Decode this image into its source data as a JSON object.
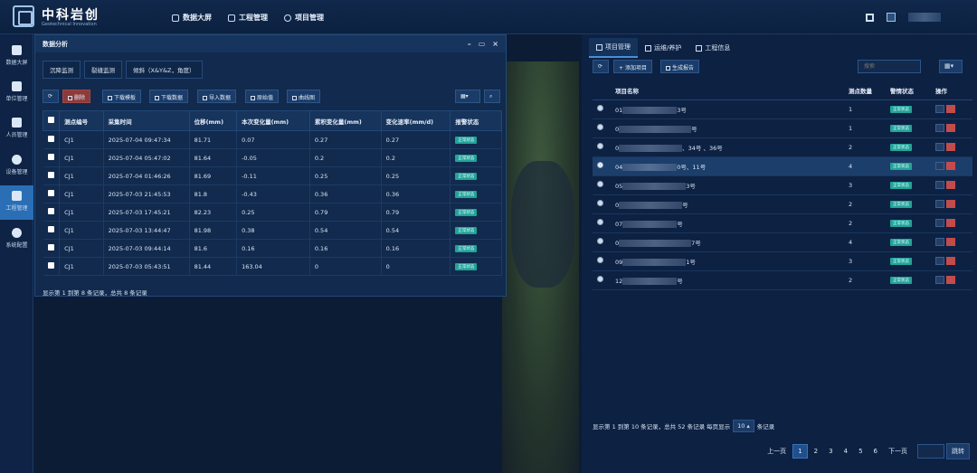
{
  "app": {
    "brand": "中科岩创",
    "brand_sub": "Geotechnical Innovation",
    "nav": [
      "数据大屏",
      "工程管理",
      "项目管理"
    ]
  },
  "sidebar": [
    {
      "label": "数据大屏",
      "icon": "cube-icon"
    },
    {
      "label": "单位管理",
      "icon": "calendar-icon"
    },
    {
      "label": "人员管理",
      "icon": "id-card-icon"
    },
    {
      "label": "设备管理",
      "icon": "gear-icon"
    },
    {
      "label": "工程管理",
      "icon": "chart-icon",
      "active": true
    },
    {
      "label": "系统配置",
      "icon": "more-icon"
    }
  ],
  "left_panel": {
    "title": "数据分析",
    "tabs": [
      "沉降监测",
      "裂缝监测",
      "倾斜（X&Y&Z，角度）"
    ],
    "toolbar": {
      "delete": "删除",
      "template": "下载模板",
      "download": "下载数据",
      "import": "导入数据",
      "raw": "原始值",
      "curve": "曲线图"
    },
    "columns": [
      "测点编号",
      "采集时间",
      "位移(mm)",
      "本次变化量(mm)",
      "累积变化量(mm)",
      "变化速率(mm/d)",
      "报警状态"
    ],
    "rows": [
      {
        "id": "CJ1",
        "time": "2025-07-04 09:47:34",
        "disp": "81.71",
        "delta": "0.07",
        "cum": "0.27",
        "rate": "0.27",
        "status": "正常状态"
      },
      {
        "id": "CJ1",
        "time": "2025-07-04 05:47:02",
        "disp": "81.64",
        "delta": "-0.05",
        "cum": "0.2",
        "rate": "0.2",
        "status": "正常状态"
      },
      {
        "id": "CJ1",
        "time": "2025-07-04 01:46:26",
        "disp": "81.69",
        "delta": "-0.11",
        "cum": "0.25",
        "rate": "0.25",
        "status": "正常状态"
      },
      {
        "id": "CJ1",
        "time": "2025-07-03 21:45:53",
        "disp": "81.8",
        "delta": "-0.43",
        "cum": "0.36",
        "rate": "0.36",
        "status": "正常状态"
      },
      {
        "id": "CJ1",
        "time": "2025-07-03 17:45:21",
        "disp": "82.23",
        "delta": "0.25",
        "cum": "0.79",
        "rate": "0.79",
        "status": "正常状态"
      },
      {
        "id": "CJ1",
        "time": "2025-07-03 13:44:47",
        "disp": "81.98",
        "delta": "0.38",
        "cum": "0.54",
        "rate": "0.54",
        "status": "正常状态"
      },
      {
        "id": "CJ1",
        "time": "2025-07-03 09:44:14",
        "disp": "81.6",
        "delta": "0.16",
        "cum": "0.16",
        "rate": "0.16",
        "status": "正常状态"
      },
      {
        "id": "CJ1",
        "time": "2025-07-03 05:43:51",
        "disp": "81.44",
        "delta": "163.04",
        "cum": "0",
        "rate": "0",
        "status": "正常状态"
      }
    ],
    "footer": "显示第 1 到第 8 条记录，总共 8 条记录"
  },
  "right_panel": {
    "tabs": [
      "项目管理",
      "运维/养护",
      "工程信息"
    ],
    "add": "添加项目",
    "report": "生成报告",
    "search_placeholder": "搜索",
    "columns": [
      "项目名称",
      "测点数量",
      "警情状态",
      "操作"
    ],
    "rows": [
      {
        "prefix": "01",
        "suffix": "3号",
        "count": "1",
        "status": "正常状态"
      },
      {
        "prefix": "0",
        "suffix": "号",
        "count": "1",
        "status": "正常状态"
      },
      {
        "prefix": "0",
        "suffix": "、34号 、36号",
        "count": "2",
        "status": "正常状态"
      },
      {
        "prefix": "04",
        "suffix": "0号、11号",
        "count": "4",
        "status": "正常状态",
        "selected": true
      },
      {
        "prefix": "05",
        "suffix": "3号",
        "count": "3",
        "status": "正常状态"
      },
      {
        "prefix": "0",
        "suffix": "号",
        "count": "2",
        "status": "正常状态"
      },
      {
        "prefix": "07",
        "suffix": "号",
        "count": "2",
        "status": "正常状态"
      },
      {
        "prefix": "0",
        "suffix": "7号",
        "count": "4",
        "status": "正常状态"
      },
      {
        "prefix": "09",
        "suffix": "1号",
        "count": "3",
        "status": "正常状态"
      },
      {
        "prefix": "12",
        "suffix": "号",
        "count": "2",
        "status": "正常状态"
      }
    ],
    "footer_text": "显示第 1 到第 10 条记录，总共 52 条记录 每页显示",
    "page_size": "10",
    "footer_tail": "条记录",
    "pager": {
      "prev": "上一页",
      "pages": [
        "1",
        "2",
        "3",
        "4",
        "5",
        "6"
      ],
      "next": "下一页",
      "jump": "跳转"
    }
  }
}
